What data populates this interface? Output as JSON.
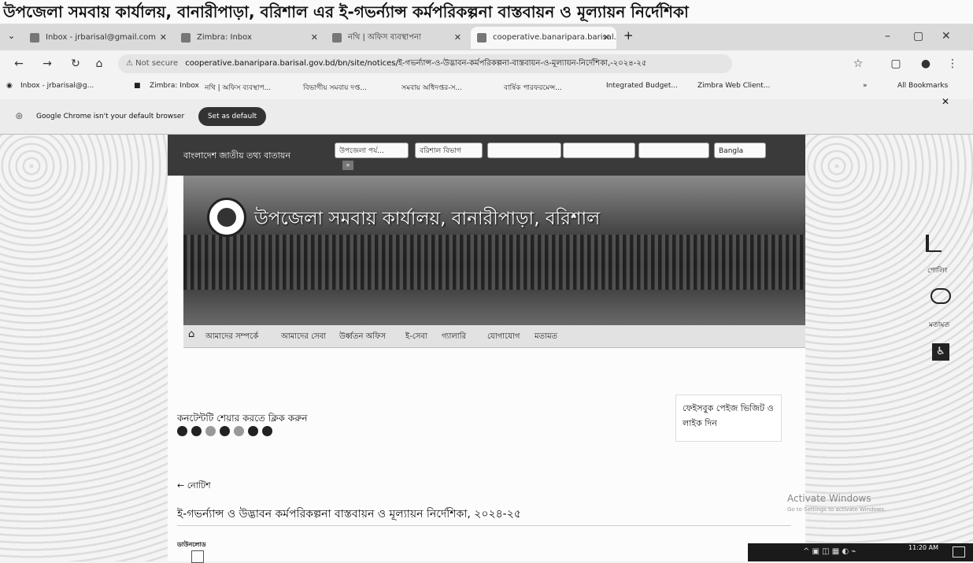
{
  "doc_heading": "উপজেলা সমবায় কার্যালয়, বানারীপাড়া, বরিশাল এর ই-গভর্ন্যান্স কর্মপরিকল্পনা বাস্তবায়ন ও মূল্যায়ন নির্দেশিকা",
  "tabs": [
    {
      "label": "Inbox - jrbarisal@gmail.com"
    },
    {
      "label": "Zimbra: Inbox"
    },
    {
      "label": "নথি | অফিস ব্যবস্থাপনা"
    },
    {
      "label": "cooperative.banaripara.barisal.gov.bd"
    }
  ],
  "window_controls": {
    "minimize": "–",
    "maximize": "▢",
    "close": "✕"
  },
  "address": {
    "security": "Not secure",
    "url": "cooperative.banaripara.barisal.gov.bd/bn/site/notices/ই-গভর্ন্যান্স-ও-উদ্ভাবন-কর্মপরিকল্পনা-বাস্তবায়ন-ও-মূল্যায়ন-নির্দেশিকা,-২০২৪-২৫"
  },
  "bookmarks": [
    "Inbox - jrbarisal@g...",
    "Zimbra: Inbox",
    "নথি | অফিস ব্যবস্থাপ...",
    "বিভাগীয় সমবায় দপ্ত...",
    "সমবায় অধিদপ্তর-স...",
    "বার্ষিক পারফরমেন্স...",
    "Integrated Budget...",
    "Zimbra Web Client...",
    "All Bookmarks"
  ],
  "default_bar": {
    "message": "Google Chrome isn't your default browser",
    "button": "Set as default"
  },
  "site": {
    "portal_title": "বাংলাদেশ জাতীয় তথ্য বাতায়ন",
    "selects": [
      "উপজেলা পর্য...",
      "বরিশাল বিভাগ",
      "",
      "",
      "",
      "Bangla"
    ],
    "office_title": "উপজেলা সমবায় কার্যালয়, বানারীপাড়া, বরিশাল",
    "menu": [
      "আমাদের সম্পর্কে",
      "আমাদের সেবা",
      "উর্ধ্বতন অফিস",
      "ই-সেবা",
      "গ্যালারি",
      "যোগাযোগ",
      "মতামত"
    ],
    "share_label": "কনটেন্টটি শেয়ার করতে ক্লিক করুন",
    "fb_box": "ফেইসবুক পেইজ ভিজিট ও লাইক দিন",
    "notice_back": "নোটিশ",
    "notice_title": "ই-গভর্ন্যান্স ও উদ্ভাবন কর্মপরিকল্পনা বাস্তবায়ন ও মূল্যায়ন নির্দেশিকা, ২০২৪-২৫",
    "attach_label": "ডাউনলোড"
  },
  "side_widgets": {
    "poll": "পোলিং",
    "feedback": "মতামত"
  },
  "activate": {
    "line1": "Activate Windows",
    "line2": "Go to Settings to activate Windows."
  },
  "taskbar": {
    "time": "11:20 AM"
  }
}
